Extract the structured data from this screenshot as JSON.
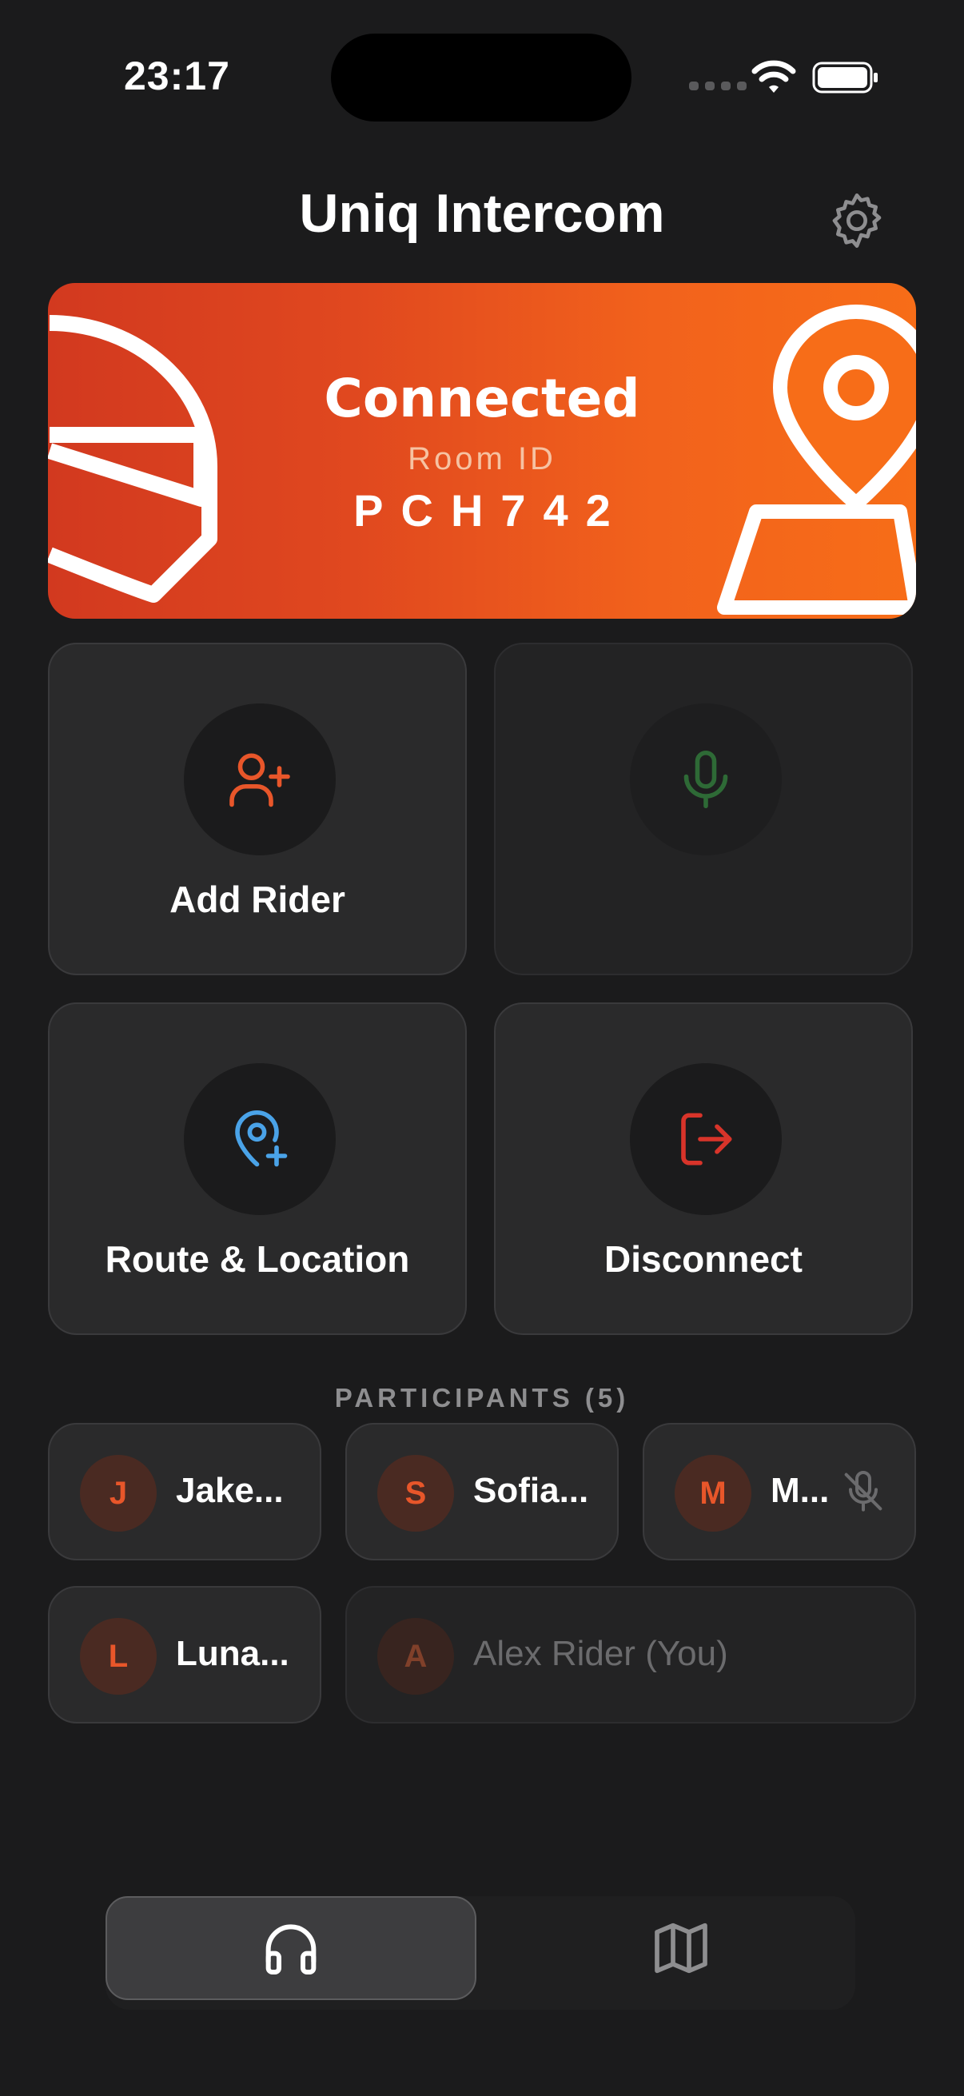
{
  "status_bar": {
    "time": "23:17"
  },
  "header": {
    "title": "Uniq Intercom"
  },
  "banner": {
    "status": "Connected",
    "room_label": "Room ID",
    "room_id": "PCH742"
  },
  "actions": {
    "add_rider": "Add Rider",
    "route_location": "Route & Location",
    "disconnect": "Disconnect"
  },
  "participants": {
    "heading": "PARTICIPANTS (5)",
    "items": [
      {
        "initial": "J",
        "name": "Jake...",
        "muted": false
      },
      {
        "initial": "S",
        "name": "Sofia...",
        "muted": false
      },
      {
        "initial": "M",
        "name": "M...",
        "muted": true
      },
      {
        "initial": "L",
        "name": "Luna...",
        "muted": false
      },
      {
        "initial": "A",
        "name": "Alex Rider (You)",
        "muted": false
      }
    ]
  },
  "tabs": [
    {
      "icon": "headphones-icon",
      "active": true
    },
    {
      "icon": "map-icon",
      "active": false
    }
  ],
  "colors": {
    "accent": "#e8562a",
    "banner_start": "#d2391f",
    "banner_end": "#f76d18",
    "location_blue": "#4aa3e8",
    "disconnect_red": "#d8342a",
    "mic_green": "#2e6a36"
  }
}
